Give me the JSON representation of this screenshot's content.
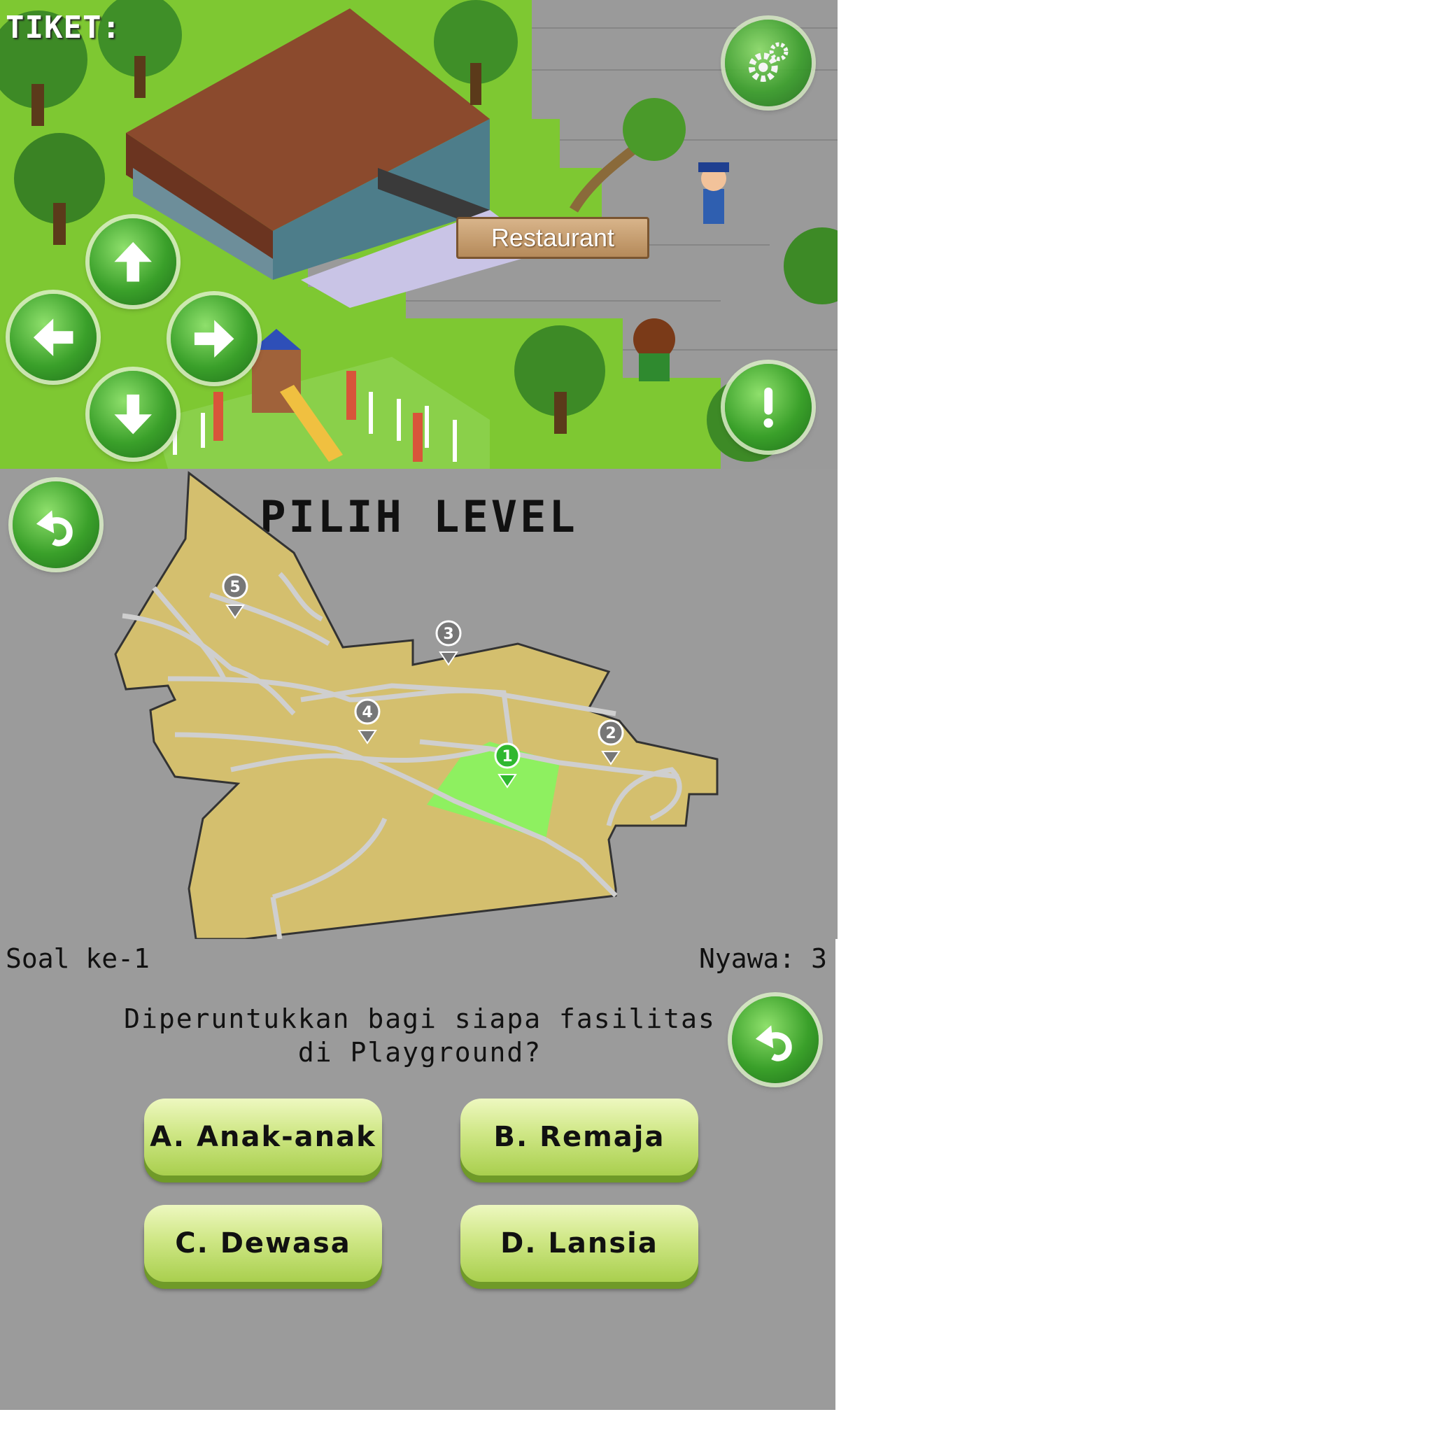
{
  "game": {
    "ticket_label": "TIKET:",
    "restaurant_sign": "Restaurant",
    "controls": {
      "up": "arrow-up-icon",
      "left": "arrow-left-icon",
      "right": "arrow-right-icon",
      "down": "arrow-down-icon",
      "settings": "gear-icon",
      "info": "exclamation-icon"
    }
  },
  "level_select": {
    "title": "PILIH LEVEL",
    "back": "back-arrow-icon",
    "markers": [
      {
        "label": "1",
        "state": "active"
      },
      {
        "label": "2",
        "state": "locked"
      },
      {
        "label": "3",
        "state": "locked"
      },
      {
        "label": "4",
        "state": "locked"
      },
      {
        "label": "5",
        "state": "locked"
      }
    ]
  },
  "quiz": {
    "question_number": "Soal ke-1",
    "lives": "Nyawa: 3",
    "question": "Diperuntukkan bagi siapa fasilitas di Playground?",
    "answers": [
      "A. Anak-anak",
      "B. Remaja",
      "C. Dewasa",
      "D. Lansia"
    ]
  },
  "colors": {
    "grass": "#7ec832",
    "panel_gray": "#9b9b9b",
    "map_land": "#d4bf6e",
    "map_active": "#8ef060",
    "button_green": "#3aa02a"
  }
}
